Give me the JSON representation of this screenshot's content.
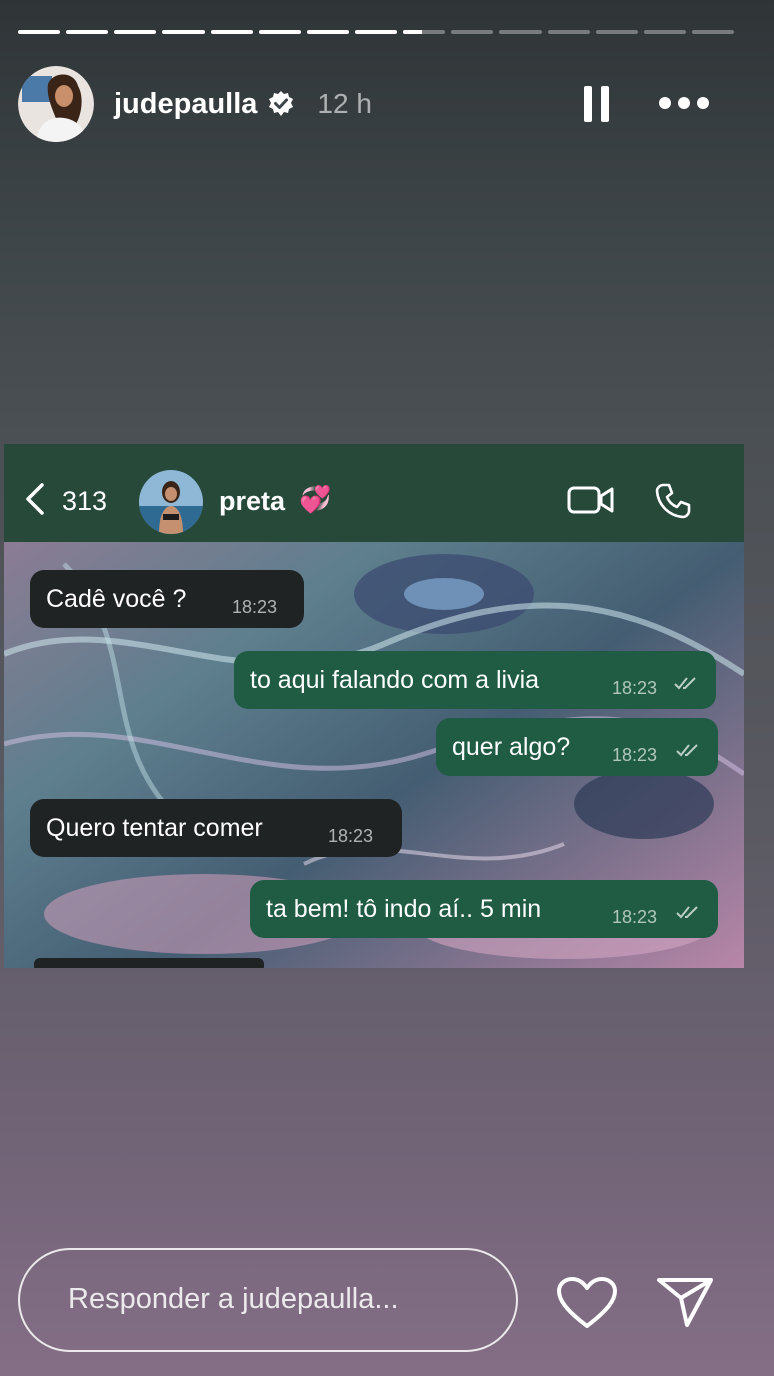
{
  "story": {
    "segments_total": 15,
    "segments_viewed": 8,
    "current_segment_progress": 0.45
  },
  "header": {
    "username": "judepaulla",
    "time": "12 h",
    "verified_icon": "verified-badge-icon",
    "pause_icon": "pause-icon",
    "more_icon": "more-icon"
  },
  "chat": {
    "back_count": "313",
    "contact_name": "preta",
    "contact_emoji": "💞",
    "header_color": "#27493a",
    "incoming_color": "#1f2324",
    "outgoing_color": "#1f5c43",
    "messages": [
      {
        "direction": "in",
        "text": "Cadê você ?",
        "time": "18:23"
      },
      {
        "direction": "out",
        "text": "to aqui falando com a livia",
        "time": "18:23"
      },
      {
        "direction": "out",
        "text": "quer algo?",
        "time": "18:23"
      },
      {
        "direction": "in",
        "text": "Quero tentar comer",
        "time": "18:23"
      },
      {
        "direction": "out",
        "text": "ta bem! tô indo aí.. 5 min",
        "time": "18:23"
      }
    ]
  },
  "footer": {
    "reply_placeholder": "Responder a judepaulla...",
    "like_icon": "heart-icon",
    "send_icon": "send-icon"
  }
}
